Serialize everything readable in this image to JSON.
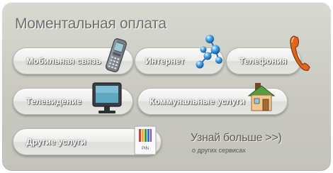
{
  "title": "Моментальная оплата",
  "services": [
    {
      "label": "Мобильная связь",
      "icon": "mobile-phone-icon"
    },
    {
      "label": "Интернет",
      "icon": "molecule-network-icon"
    },
    {
      "label": "Телефония",
      "icon": "telephone-handset-icon"
    },
    {
      "label": "Телевидение",
      "icon": "tv-icon"
    },
    {
      "label": "Коммунальные услуги",
      "icon": "house-icon"
    },
    {
      "label": "Другие услуги",
      "icon": "pin-card-icon"
    }
  ],
  "pin_text": "PIN",
  "learn_more": {
    "main": "Узнай больше",
    "arrows": ">>)",
    "sub": "о других сервисах"
  },
  "colors": {
    "panel": "#cfcfc8",
    "title": "#6e6e6e",
    "button": "#ececea",
    "label": "#ffffff"
  }
}
